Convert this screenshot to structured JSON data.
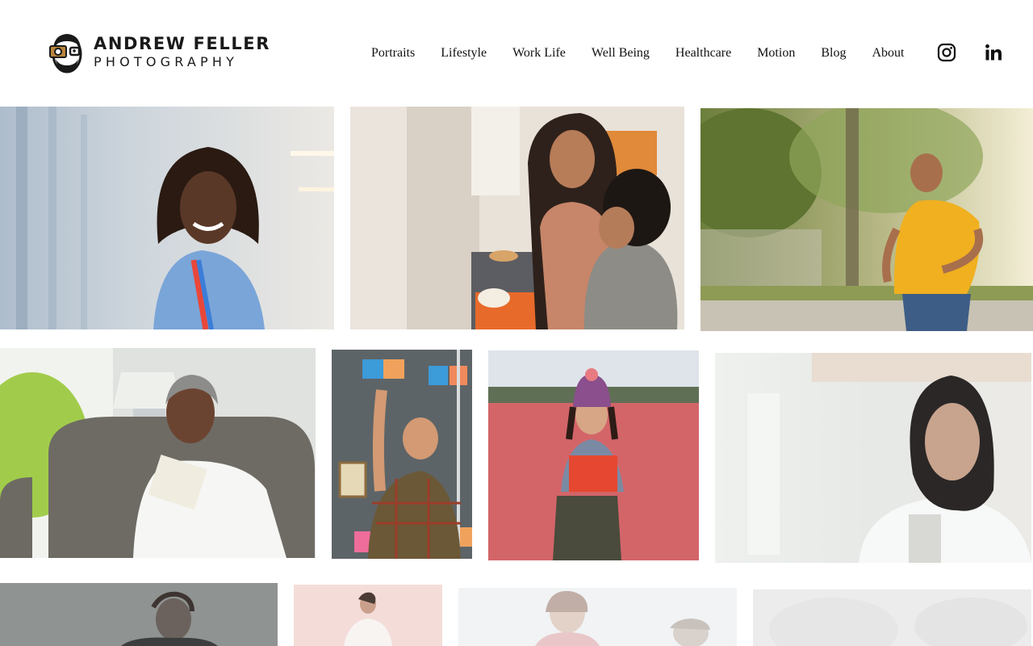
{
  "site": {
    "logo_line1": "ANDREW FELLER",
    "logo_line2": "PHOTOGRAPHY",
    "logo_icon": "photographer-face-camera-icon"
  },
  "nav": {
    "items": [
      {
        "label": "Portraits"
      },
      {
        "label": "Lifestyle"
      },
      {
        "label": "Work Life"
      },
      {
        "label": "Well Being"
      },
      {
        "label": "Healthcare"
      },
      {
        "label": "Motion"
      },
      {
        "label": "Blog"
      },
      {
        "label": "About"
      }
    ]
  },
  "social": {
    "instagram_icon": "instagram-icon",
    "linkedin_icon": "linkedin-icon"
  },
  "gallery": {
    "photos": [
      {
        "subject": "nurse-portrait"
      },
      {
        "subject": "mother-son-kitchen"
      },
      {
        "subject": "man-running"
      },
      {
        "subject": "woman-reading-armchair"
      },
      {
        "subject": "man-sticky-notes"
      },
      {
        "subject": "woman-cranberry-bog"
      },
      {
        "subject": "doctor-portrait"
      },
      {
        "subject": "woman-phone-dark"
      },
      {
        "subject": "person-pink-backdrop"
      },
      {
        "subject": "two-people-outdoors"
      },
      {
        "subject": "grey-backdrop"
      }
    ]
  },
  "colors": {
    "text": "#111111",
    "background": "#ffffff",
    "logo_accent": "#b8863b"
  }
}
